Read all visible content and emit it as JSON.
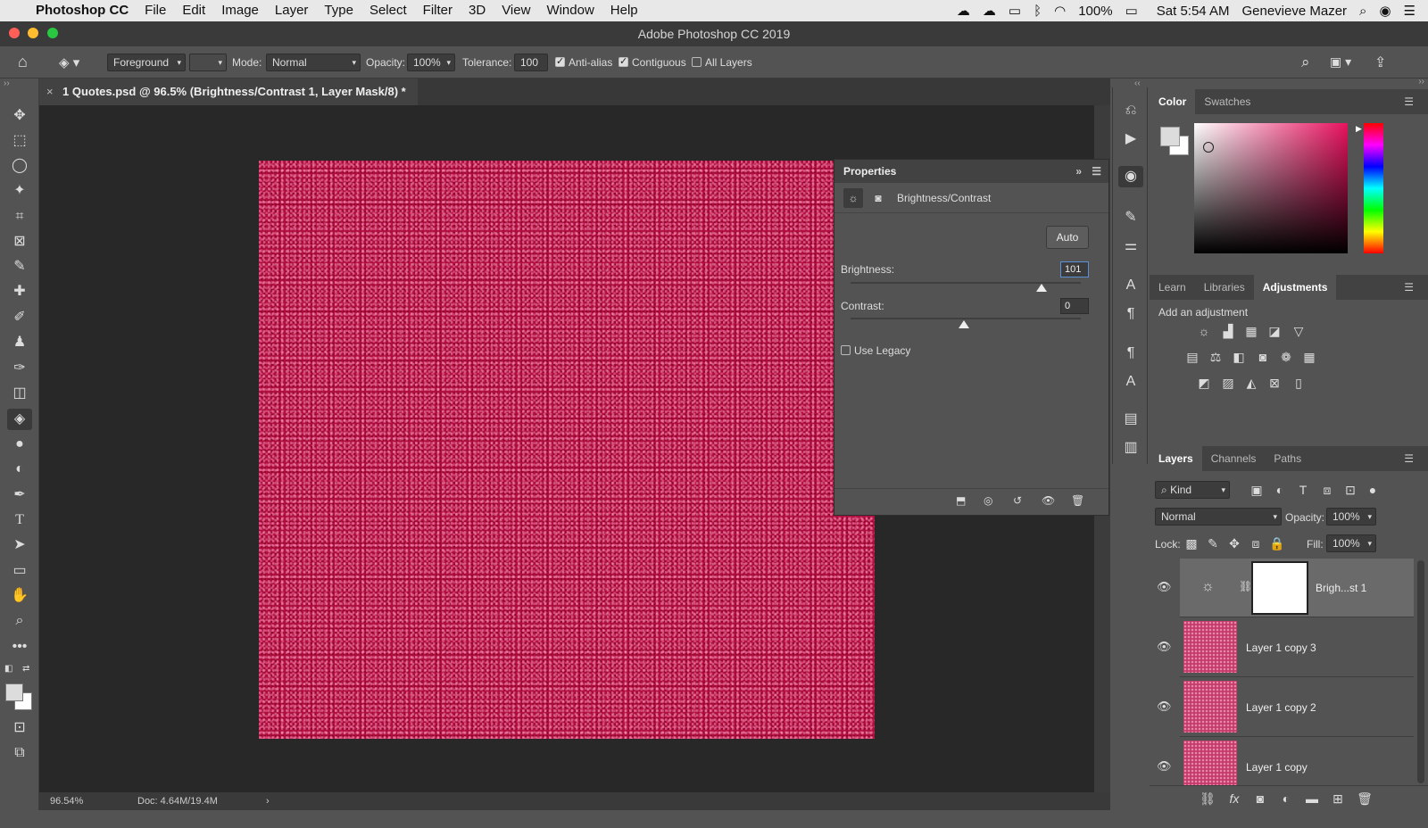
{
  "menubar": {
    "apple": "",
    "app": "Photoshop CC",
    "items": [
      "File",
      "Edit",
      "Image",
      "Layer",
      "Type",
      "Select",
      "Filter",
      "3D",
      "View",
      "Window",
      "Help"
    ],
    "battery": "100%",
    "time": "Sat 5:54 AM",
    "user": "Genevieve Mazer"
  },
  "window": {
    "title": "Adobe Photoshop CC 2019"
  },
  "options": {
    "fill_source": "Foreground",
    "mode_label": "Mode:",
    "mode_value": "Normal",
    "opacity_label": "Opacity:",
    "opacity_value": "100%",
    "tolerance_label": "Tolerance:",
    "tolerance_value": "100",
    "antialias": "Anti-alias",
    "contiguous": "Contiguous",
    "all_layers": "All Layers"
  },
  "document": {
    "tab_title": "1 Quotes.psd @ 96.5% (Brightness/Contrast 1, Layer Mask/8) *",
    "zoom": "96.54%",
    "doc_size": "Doc: 4.64M/19.4M",
    "canvas_color": "#b00e3e"
  },
  "properties": {
    "title": "Properties",
    "adjustment": "Brightness/Contrast",
    "auto_label": "Auto",
    "brightness_label": "Brightness:",
    "brightness_value": "101",
    "contrast_label": "Contrast:",
    "contrast_value": "0",
    "legacy_label": "Use Legacy"
  },
  "color_panel": {
    "tabs": [
      "Color",
      "Swatches"
    ]
  },
  "adjust_panel": {
    "tabs": [
      "Learn",
      "Libraries",
      "Adjustments"
    ],
    "add_label": "Add an adjustment"
  },
  "layers_panel": {
    "tabs": [
      "Layers",
      "Channels",
      "Paths"
    ],
    "filter_kind": "Kind",
    "blend_mode": "Normal",
    "opacity_label": "Opacity:",
    "opacity_value": "100%",
    "lock_label": "Lock:",
    "fill_label": "Fill:",
    "fill_value": "100%",
    "layers": [
      {
        "name": "Brigh...st 1"
      },
      {
        "name": "Layer 1 copy 3"
      },
      {
        "name": "Layer 1 copy 2"
      },
      {
        "name": "Layer 1 copy"
      }
    ]
  }
}
